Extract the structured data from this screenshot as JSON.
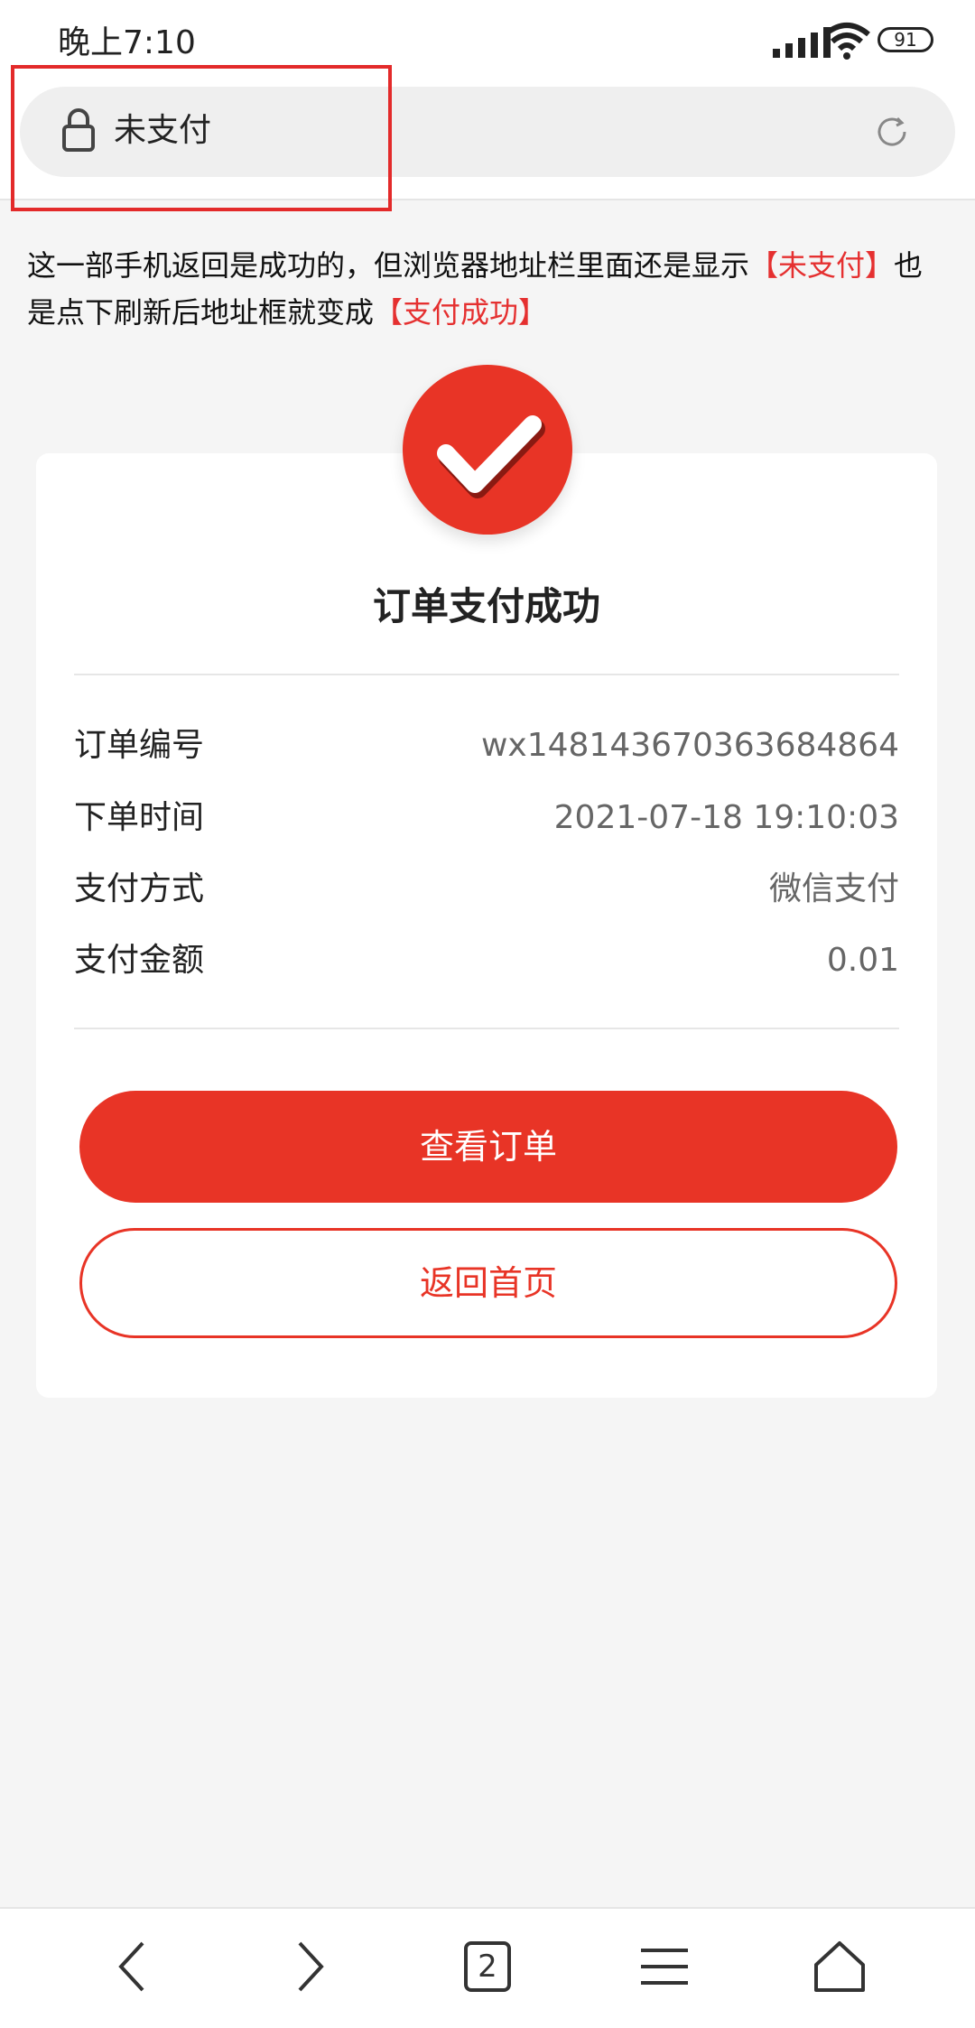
{
  "status_bar": {
    "time": "晚上7:10",
    "battery": "91"
  },
  "browser": {
    "address_text": "未支付"
  },
  "note": {
    "part1": "这一部手机返回是成功的，但浏览器地址栏里面还是显示",
    "highlight1": "【未支付】",
    "part2": "也是点下刷新后地址框就变成",
    "highlight2": "【支付成功】"
  },
  "card": {
    "title": "订单支付成功",
    "rows": [
      {
        "label": "订单编号",
        "value": "wx14814367036368486​4"
      },
      {
        "label": "下单时间",
        "value": "2021-07-18 19:10:03"
      },
      {
        "label": "支付方式",
        "value": "微信支付"
      },
      {
        "label": "支付金额",
        "value": "0.01"
      }
    ],
    "primary_button": "查看订单",
    "secondary_button": "返回首页"
  },
  "bottom_nav": {
    "tabs_count": "2"
  },
  "colors": {
    "accent": "#e83426",
    "highlight_box": "#e32a2a"
  }
}
